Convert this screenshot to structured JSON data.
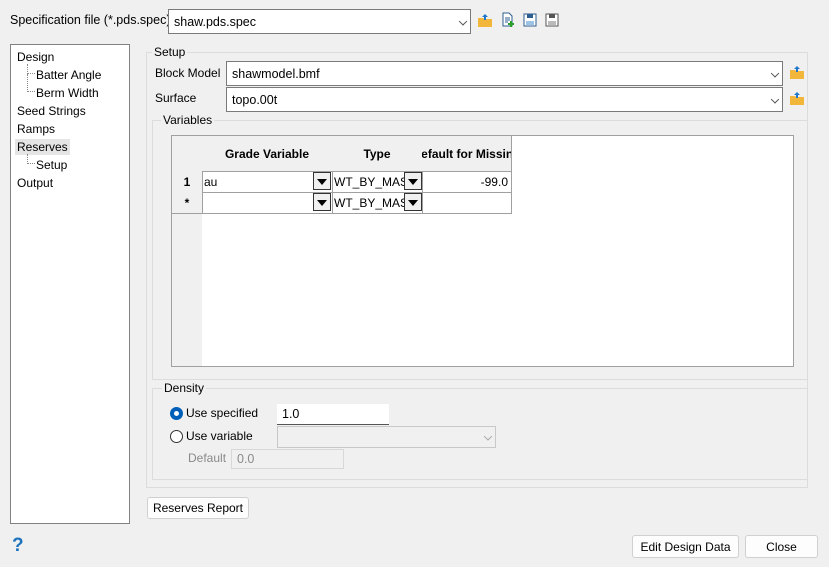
{
  "spec": {
    "label": "Specification file (*.pds.spec)",
    "value": "shaw.pds.spec"
  },
  "toolbar_icons": [
    "open-folder-icon",
    "new-file-icon",
    "save-icon",
    "save-as-icon"
  ],
  "tree": [
    {
      "label": "Design",
      "level": 0
    },
    {
      "label": "Batter Angle",
      "level": 1
    },
    {
      "label": "Berm Width",
      "level": 1
    },
    {
      "label": "Seed Strings",
      "level": 0
    },
    {
      "label": "Ramps",
      "level": 0
    },
    {
      "label": "Reserves",
      "level": 0,
      "selected": true
    },
    {
      "label": "Setup",
      "level": 1
    },
    {
      "label": "Output",
      "level": 0
    }
  ],
  "setup": {
    "title": "Setup",
    "block_model_label": "Block Model",
    "block_model": "shawmodel.bmf",
    "surface_label": "Surface",
    "surface": "topo.00t"
  },
  "variables": {
    "title": "Variables",
    "headers": [
      "Grade Variable",
      "Type",
      "Default for Missing"
    ],
    "rows": [
      {
        "num": "1",
        "grade": "au",
        "type": "WT_BY_MAS",
        "default": "-99.0"
      },
      {
        "num": "*",
        "grade": "",
        "type": "WT_BY_MAS",
        "default": ""
      }
    ]
  },
  "density": {
    "title": "Density",
    "use_specified": "Use specified",
    "specified_value": "1.0",
    "use_variable": "Use variable",
    "variable_value": "",
    "default_label": "Default",
    "default_value": "0.0",
    "selected": "use_specified"
  },
  "buttons": {
    "reserves_report": "Reserves Report",
    "edit_design": "Edit Design Data",
    "close": "Close",
    "help": "?"
  },
  "colors": {
    "accent": "#005fb8",
    "help": "#1e73be"
  }
}
